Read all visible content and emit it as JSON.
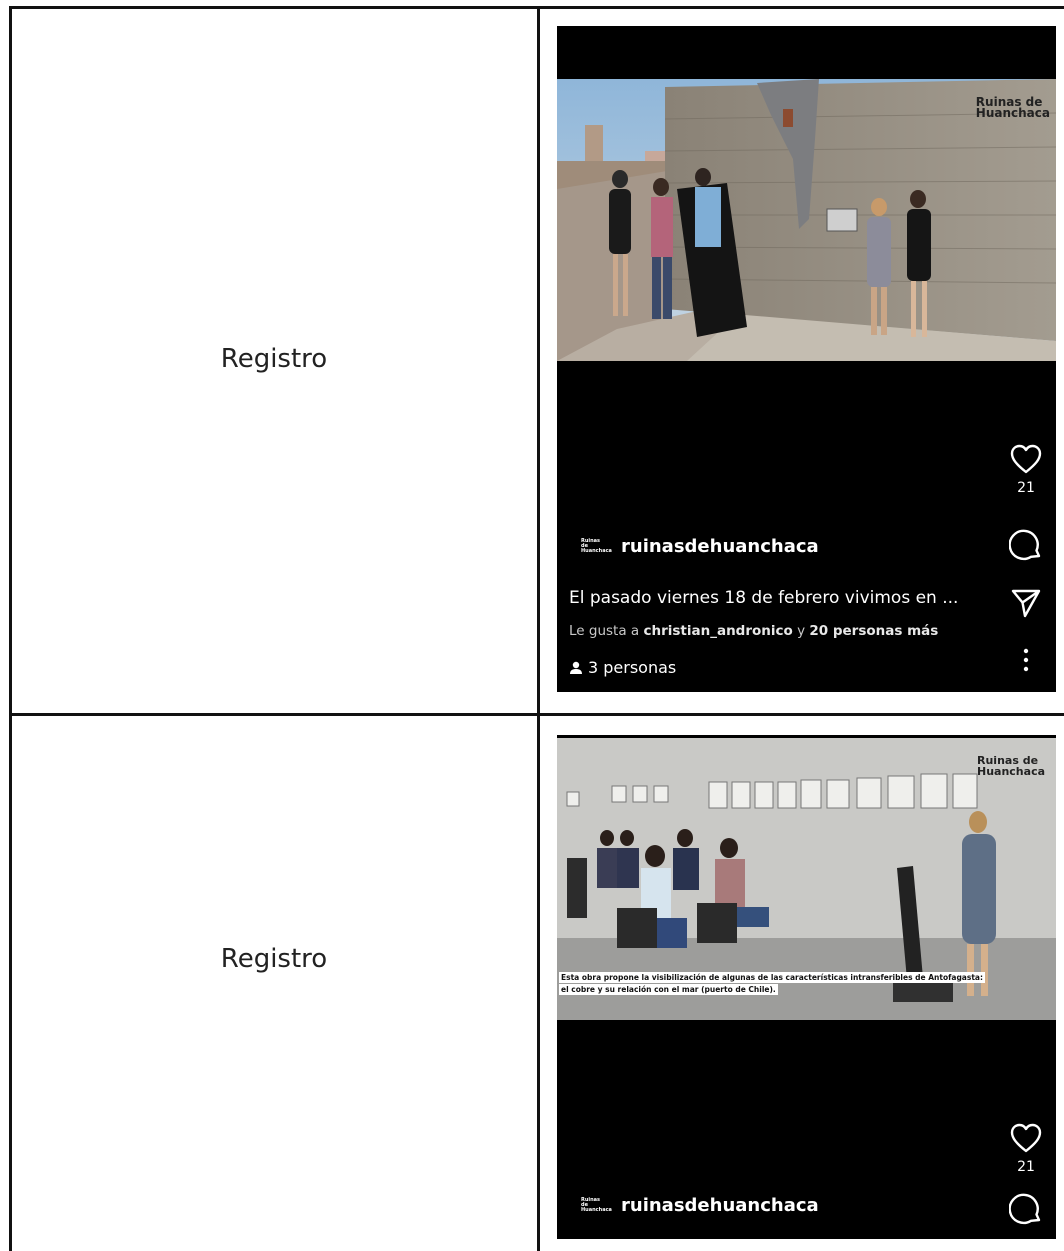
{
  "rows": [
    {
      "label": "Registro",
      "reel": {
        "brand": [
          "Ruinas de",
          "Huanchaca"
        ],
        "avatar_text": [
          "Ruinas de",
          "Huanchaca"
        ],
        "username": "ruinasdehuanchaca",
        "like_count": "21",
        "caption": "El pasado viernes 18 de febrero vivimos en ...",
        "likes_prefix": "Le gusta a ",
        "likes_user": "christian_andronico",
        "likes_mid": " y ",
        "likes_others": "20 personas más",
        "people_tag": "3 personas"
      }
    },
    {
      "label": "Registro",
      "reel": {
        "brand": [
          "Ruinas de",
          "Huanchaca"
        ],
        "avatar_text": [
          "Ruinas de",
          "Huanchaca"
        ],
        "username": "ruinasdehuanchaca",
        "like_count": "21",
        "subtitle_line1": "Esta obra propone la visibilización de algunas de las características intransferibles de Antofagasta:",
        "subtitle_line2": "el cobre y su relación con el mar (puerto de Chile)."
      }
    }
  ],
  "icons": {
    "like": "heart-outline-icon",
    "comment": "comment-bubble-icon",
    "share": "paper-plane-icon",
    "more": "vertical-dots-icon",
    "people": "person-icon"
  },
  "colors": {
    "reel_bg": "#000000",
    "text_primary": "#ffffff",
    "text_secondary": "#c8c8c8",
    "table_border": "#111111"
  }
}
